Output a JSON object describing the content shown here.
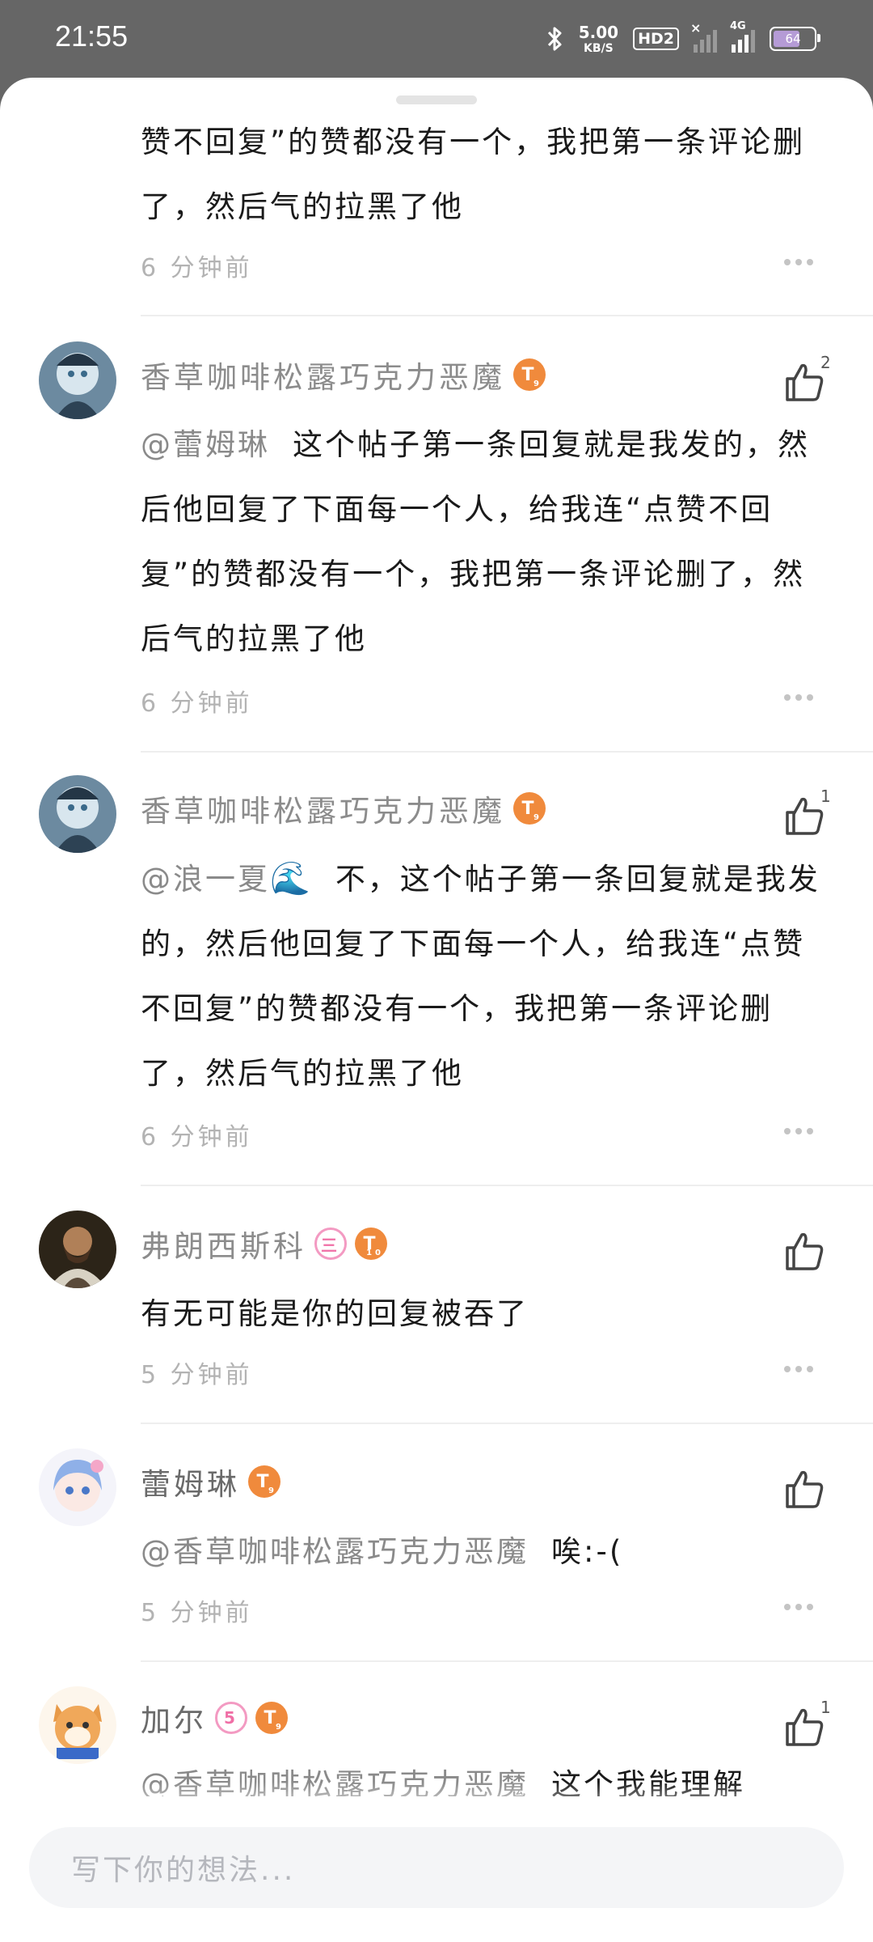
{
  "status_bar": {
    "time": "21:55",
    "net_speed": "5.00",
    "net_unit": "KB/S",
    "hd": "HD2",
    "network": "4G",
    "battery": "64"
  },
  "comments": [
    {
      "text": "赞不回复”的赞都没有一个，我把第一条评论删了，然后气的拉黑了他",
      "time": "6 分钟前"
    },
    {
      "user": "香草咖啡松露巧克力恶魔",
      "level": "T",
      "level_num": "9",
      "mention": "@蕾姆琳",
      "text": "这个帖子第一条回复就是我发的，然后他回复了下面每一个人，给我连“点赞不回复”的赞都没有一个，我把第一条评论删了，然后气的拉黑了他",
      "time": "6 分钟前",
      "likes": "2"
    },
    {
      "user": "香草咖啡松露巧克力恶魔",
      "level": "T",
      "level_num": "9",
      "mention": "@浪一夏",
      "text": "不，这个帖子第一条回复就是我发的，然后他回复了下面每一个人，给我连“点赞不回复”的赞都没有一个，我把第一条评论删了，然后气的拉黑了他",
      "time": "6 分钟前",
      "likes": "1"
    },
    {
      "user": "弗朗西斯科",
      "badge": "三",
      "level": "T",
      "level_num": "10",
      "text": "有无可能是你的回复被吞了",
      "time": "5 分钟前"
    },
    {
      "user": "蕾姆琳",
      "level": "T",
      "level_num": "9",
      "mention": "@香草咖啡松露巧克力恶魔",
      "text": "唉:-(",
      "time": "5 分钟前"
    },
    {
      "user": "加尔",
      "badge": "5",
      "level": "T",
      "level_num": "9",
      "mention": "@香草咖啡松露巧克力恶魔",
      "text": "这个我能理解",
      "likes": "1"
    }
  ],
  "input": {
    "placeholder": "写下你的想法..."
  }
}
